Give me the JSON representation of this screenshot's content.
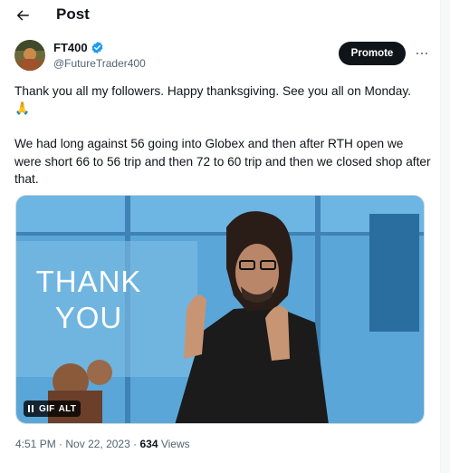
{
  "header": {
    "title": "Post"
  },
  "author": {
    "display_name": "FT400",
    "handle": "@FutureTrader400",
    "verified": true
  },
  "actions": {
    "promote_label": "Promote"
  },
  "tweet": {
    "line1": "Thank you all my followers. Happy thanksgiving. See you all on Monday.",
    "emoji": "🙏",
    "para2": "We had long against 56 going into Globex and then after RTH open we were short 66 to 56 trip and then 72 to 60 trip and then we closed shop after that."
  },
  "media": {
    "overlay_text_line1": "THANK",
    "overlay_text_line2": "YOU",
    "gif_label": "GIF",
    "alt_label": "ALT"
  },
  "meta": {
    "time": "4:51 PM",
    "sep": "·",
    "date": "Nov 22, 2023",
    "views_count": "634",
    "views_label": "Views"
  },
  "colors": {
    "accent": "#1d9bf0",
    "text": "#0f1419",
    "secondary": "#536471"
  },
  "icons": [
    "back-arrow-icon",
    "verified-badge-icon",
    "more-icon",
    "pause-icon",
    "pray-emoji"
  ]
}
